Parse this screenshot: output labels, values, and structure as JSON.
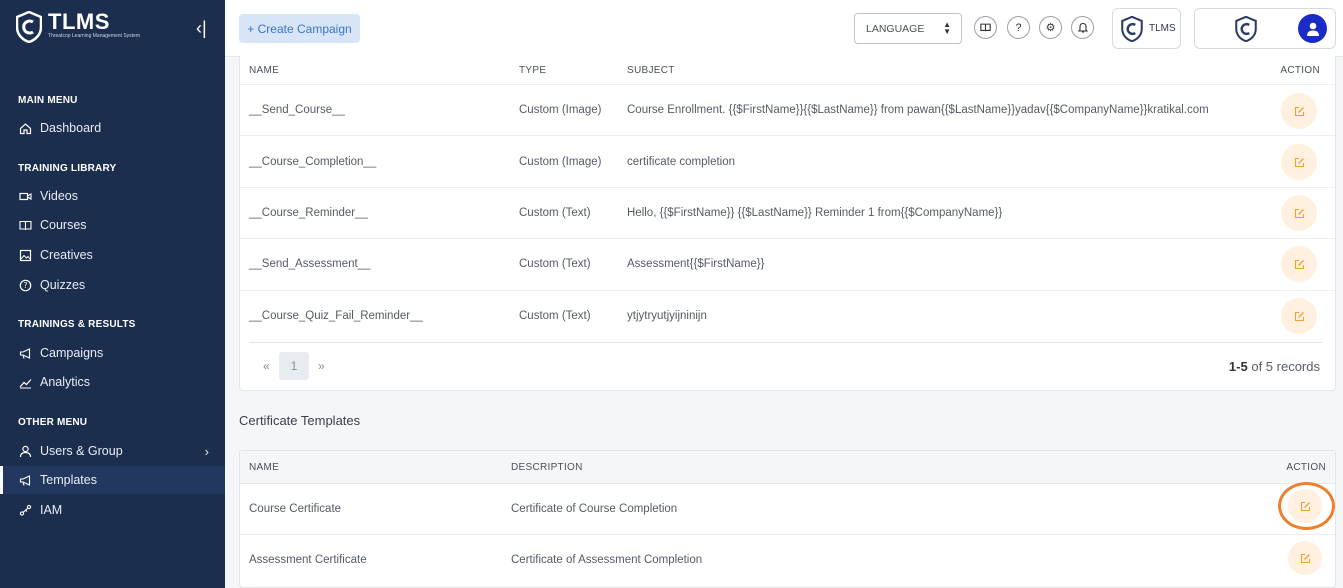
{
  "brand": {
    "name": "TLMS",
    "tagline": "Threatcop Learning Management System",
    "short": "TLMS"
  },
  "sidebar": {
    "collapse_icon": "collapse-icon",
    "sections": [
      {
        "label": "MAIN MENU"
      },
      {
        "label": "TRAINING LIBRARY"
      },
      {
        "label": "TRAININGS & RESULTS"
      },
      {
        "label": "OTHER MENU"
      }
    ],
    "items": [
      {
        "label": "Dashboard",
        "icon": "home-icon"
      },
      {
        "label": "Videos",
        "icon": "video-icon"
      },
      {
        "label": "Courses",
        "icon": "book-icon"
      },
      {
        "label": "Creatives",
        "icon": "image-icon"
      },
      {
        "label": "Quizzes",
        "icon": "question-icon"
      },
      {
        "label": "Campaigns",
        "icon": "megaphone-icon"
      },
      {
        "label": "Analytics",
        "icon": "chart-icon"
      },
      {
        "label": "Users & Group",
        "icon": "user-icon"
      },
      {
        "label": "Templates",
        "icon": "megaphone-icon",
        "active": true
      },
      {
        "label": "IAM",
        "icon": "iam-icon"
      }
    ]
  },
  "topbar": {
    "create_label": "+ Create Campaign",
    "language_label": "LANGUAGE",
    "icons": [
      "book-icon",
      "help-icon",
      "settings-icon",
      "bell-icon"
    ],
    "brand_label": "TLMS"
  },
  "email_table": {
    "headers": {
      "name": "NAME",
      "type": "TYPE",
      "subject": "SUBJECT",
      "action": "ACTION"
    },
    "rows": [
      {
        "name": "__Send_Course__",
        "type": "Custom (Image)",
        "subject": "Course Enrollment. {{$FirstName}}{{$LastName}} from pawan{{$LastName}}yadav{{$CompanyName}}kratikal.com"
      },
      {
        "name": "__Course_Completion__",
        "type": "Custom (Image)",
        "subject": "certificate completion"
      },
      {
        "name": "__Course_Reminder__",
        "type": "Custom (Text)",
        "subject": "Hello, {{$FirstName}} {{$LastName}} Reminder 1 from{{$CompanyName}}"
      },
      {
        "name": "__Send_Assessment__",
        "type": "Custom (Text)",
        "subject": "Assessment{{$FirstName}}"
      },
      {
        "name": "__Course_Quiz_Fail_Reminder__",
        "type": "Custom (Text)",
        "subject": "ytjytryutjyijninijn"
      }
    ],
    "pagination": {
      "prev": "«",
      "page": "1",
      "next": "»",
      "range": "1-5",
      "of_text": "of 5 records"
    }
  },
  "certificate": {
    "title": "Certificate Templates",
    "headers": {
      "name": "NAME",
      "description": "DESCRIPTION",
      "action": "ACTION"
    },
    "rows": [
      {
        "name": "Course Certificate",
        "description": "Certificate of Course Completion"
      },
      {
        "name": "Assessment Certificate",
        "description": "Certificate of Assessment Completion"
      }
    ]
  },
  "colors": {
    "sidebar": "#1c2e4e",
    "accent": "#3d74c8",
    "edit_bg": "#fff0df",
    "edit_icon": "#f0a030",
    "highlight": "#f07f2d"
  }
}
